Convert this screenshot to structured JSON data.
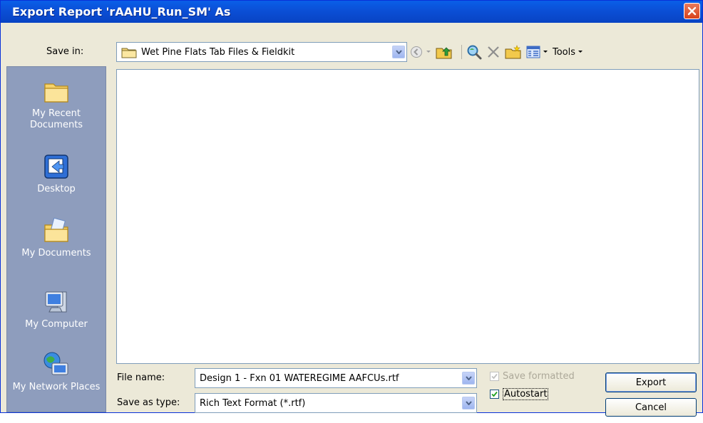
{
  "window": {
    "title": "Export Report 'rAAHU_Run_SM' As"
  },
  "save_in": {
    "label": "Save in:",
    "folder": "Wet Pine Flats Tab Files & Fieldkit"
  },
  "toolbar": {
    "tools_label": "Tools",
    "icons": [
      "back-icon",
      "up-folder-icon",
      "search-web-icon",
      "delete-icon",
      "new-folder-icon",
      "views-icon"
    ]
  },
  "places": [
    {
      "label": "My Recent Documents",
      "icon": "recent-documents-icon"
    },
    {
      "label": "Desktop",
      "icon": "desktop-icon"
    },
    {
      "label": "My Documents",
      "icon": "my-documents-icon"
    },
    {
      "label": "My Computer",
      "icon": "my-computer-icon"
    },
    {
      "label": "My Network Places",
      "icon": "network-places-icon"
    }
  ],
  "file_name": {
    "label": "File name:",
    "value": "Design 1 - Fxn 01 WATEREGIME AAFCUs.rtf"
  },
  "save_as_type": {
    "label": "Save as type:",
    "value": "Rich Text Format (*.rtf)"
  },
  "options": {
    "save_formatted": {
      "label": "Save formatted",
      "checked": true,
      "enabled": false
    },
    "autostart": {
      "label": "Autostart",
      "checked": true,
      "enabled": true
    }
  },
  "buttons": {
    "export": "Export",
    "cancel": "Cancel"
  },
  "colors": {
    "title_bar": "#0a5fe8",
    "dialog_bg": "#ece9d8",
    "places_bar": "#8e9dbd",
    "close_button": "#d8421b"
  }
}
